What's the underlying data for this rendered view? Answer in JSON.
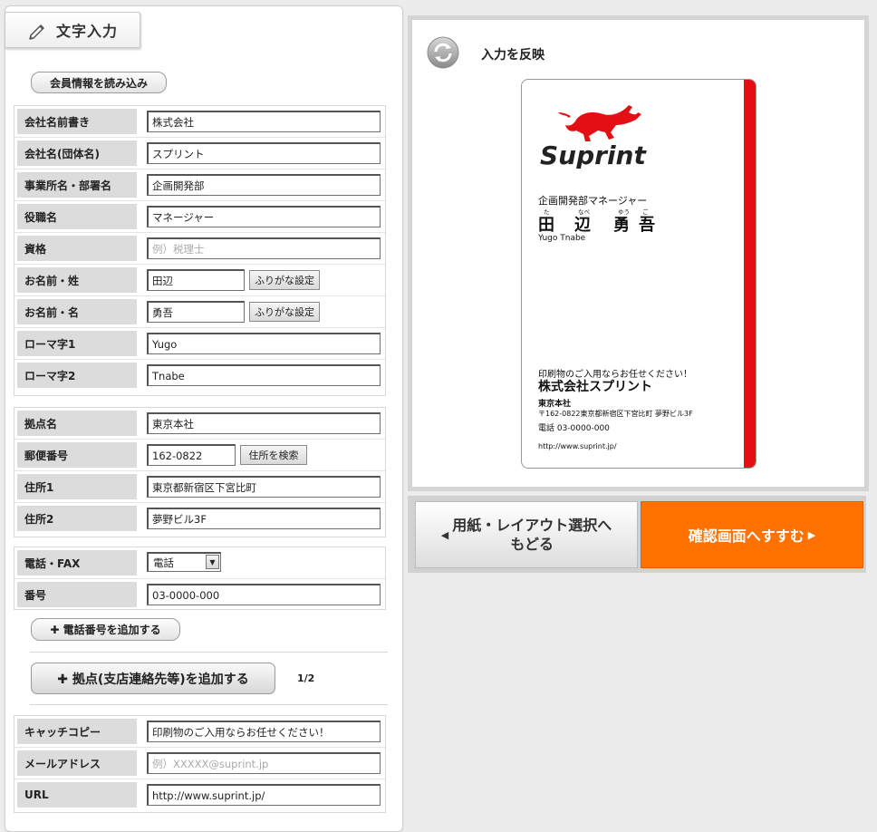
{
  "panel": {
    "title": "文字入力",
    "load_member": "会員情報を読み込み"
  },
  "group1": [
    {
      "label": "会社名前書き",
      "value": "株式会社",
      "placeholder": ""
    },
    {
      "label": "会社名(団体名)",
      "value": "スプリント",
      "placeholder": ""
    },
    {
      "label": "事業所名・部署名",
      "value": "企画開発部",
      "placeholder": ""
    },
    {
      "label": "役職名",
      "value": "マネージャー",
      "placeholder": ""
    },
    {
      "label": "資格",
      "value": "",
      "placeholder": "例）税理士"
    },
    {
      "label": "お名前・姓",
      "value": "田辺",
      "placeholder": "",
      "button": "ふりがな設定"
    },
    {
      "label": "お名前・名",
      "value": "勇吾",
      "placeholder": "",
      "button": "ふりがな設定"
    },
    {
      "label": "ローマ字1",
      "value": "Yugo",
      "placeholder": ""
    },
    {
      "label": "ローマ字2",
      "value": "Tnabe",
      "placeholder": ""
    }
  ],
  "group2": [
    {
      "label": "拠点名",
      "value": "東京本社"
    },
    {
      "label": "郵便番号",
      "value": "162-0822",
      "button": "住所を検索"
    },
    {
      "label": "住所1",
      "value": "東京都新宿区下宮比町"
    },
    {
      "label": "住所2",
      "value": "夢野ビル3F"
    }
  ],
  "group3": {
    "phone_label": "電話・FAX",
    "phone_type": "電話",
    "phone_arrow": "▼",
    "number_label": "番号",
    "number_value": "03-0000-000"
  },
  "add_phone": "✚ 電話番号を追加する",
  "add_office": "✚ 拠点(支店連絡先等)を追加する",
  "page_count": "1/2",
  "group4": [
    {
      "label": "キャッチコピー",
      "value": "印刷物のご入用ならお任せください！",
      "placeholder": ""
    },
    {
      "label": "メールアドレス",
      "value": "",
      "placeholder": "例）XXXXX@suprint.jp"
    },
    {
      "label": "URL",
      "value": "http://www.suprint.jp/",
      "placeholder": ""
    }
  ],
  "preview": {
    "reflect_label": "入力を反映",
    "card": {
      "logo_text": "Suprint",
      "dept_title": "企画開発部マネージャー",
      "furigana": [
        "た",
        "なべ",
        "ゆう",
        "ご"
      ],
      "name_chars": [
        "田",
        "辺",
        "勇",
        "吾"
      ],
      "roman": "Yugo Tnabe",
      "catch": "印刷物のご入用ならお任せください！",
      "company": "株式会社スプリント",
      "office": "東京本社",
      "address": "〒162-0822東京都新宿区下宮比町 夢野ビル3F",
      "tel": "電話 03-0000-000",
      "url": "http://www.suprint.jp/"
    }
  },
  "nav": {
    "back_line1": "用紙・レイアウト選択へ",
    "back_line2": "もどる",
    "back_arrow": "◀",
    "next_label": "確認画面へすすむ",
    "next_arrow": "▶"
  },
  "colors": {
    "accent_orange": "#ff7200",
    "card_red": "#e40e15"
  }
}
